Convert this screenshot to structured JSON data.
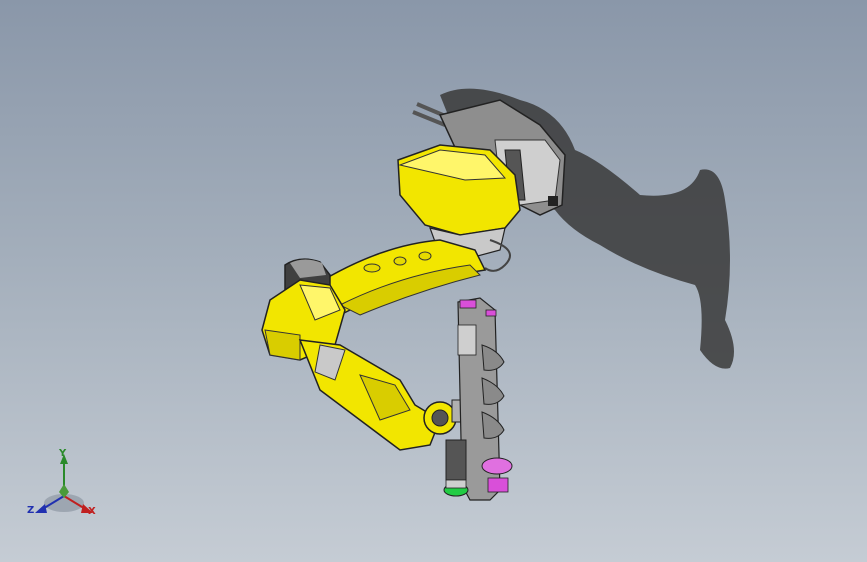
{
  "view": {
    "background_top": "#8a97a9",
    "background_bottom": "#c5ccd4",
    "model_primary_color": "#f2e600",
    "model_secondary_color": "#5a5a5a",
    "accent_color": "#d94fd9"
  },
  "triad": {
    "x_label": "X",
    "y_label": "Y",
    "z_label": "Z",
    "x_color": "#c02020",
    "y_color": "#2a8a2a",
    "z_color": "#2030b0"
  }
}
